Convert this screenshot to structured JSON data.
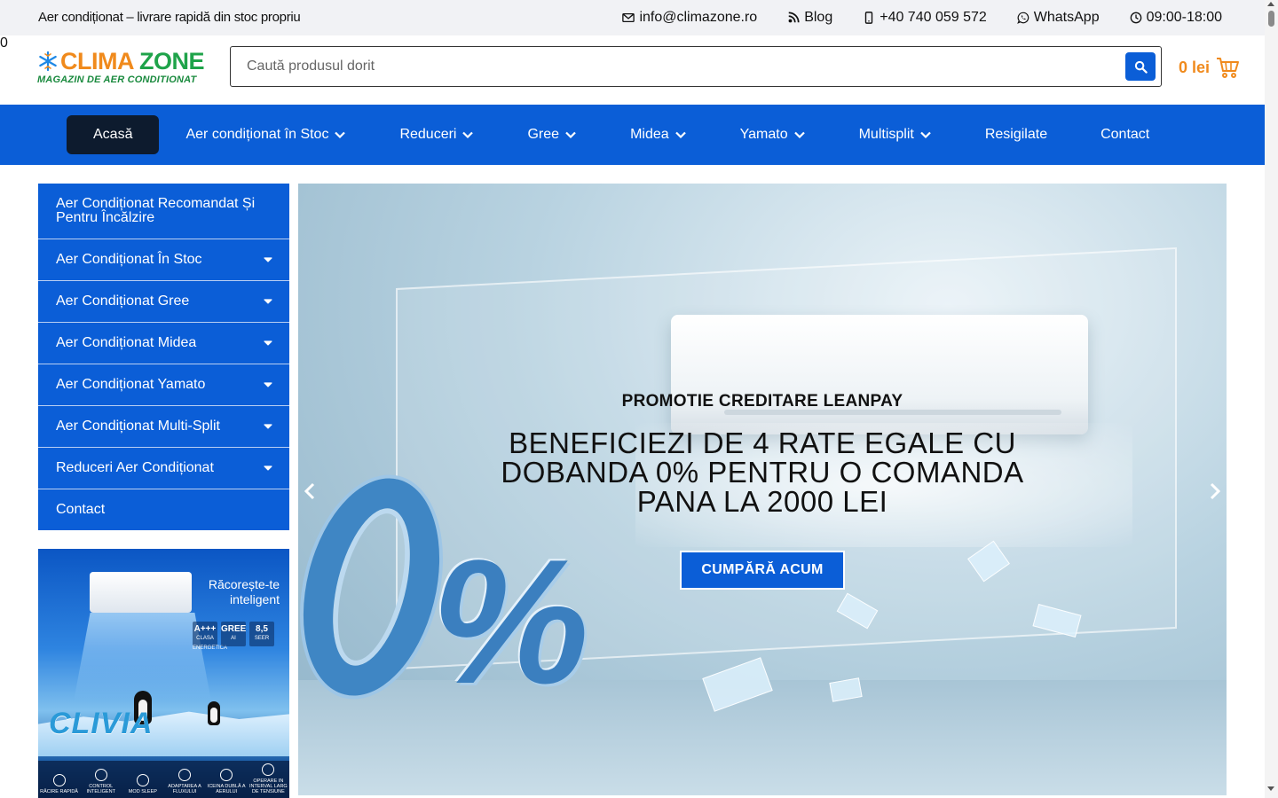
{
  "topbar": {
    "tagline": "Aer condiționat – livrare rapidă din stoc propriu",
    "contacts": [
      {
        "icon": "mail-icon",
        "label": "info@climazone.ro"
      },
      {
        "icon": "blog-icon",
        "label": "Blog"
      },
      {
        "icon": "phone-icon",
        "label": "+40 740 059 572"
      },
      {
        "icon": "whatsapp-icon",
        "label": "WhatsApp"
      },
      {
        "icon": "clock-icon",
        "label": "09:00-18:00"
      }
    ]
  },
  "header": {
    "logo": {
      "part1": "CLIMA",
      "part2": "ZONE",
      "subtitle": "MAGAZIN DE AER CONDITIONAT"
    },
    "search": {
      "placeholder": "Caută produsul dorit",
      "button_icon": "search-icon"
    },
    "cart": {
      "amount": "0 lei",
      "count": "0",
      "icon": "cart-icon"
    }
  },
  "nav": {
    "items": [
      {
        "label": "Acasă",
        "active": true,
        "dropdown": false
      },
      {
        "label": "Aer condiționat în Stoc",
        "dropdown": true
      },
      {
        "label": "Reduceri",
        "dropdown": true
      },
      {
        "label": "Gree",
        "dropdown": true
      },
      {
        "label": "Midea",
        "dropdown": true
      },
      {
        "label": "Yamato",
        "dropdown": true
      },
      {
        "label": "Multisplit",
        "dropdown": true
      },
      {
        "label": "Resigilate",
        "dropdown": false
      },
      {
        "label": "Contact",
        "dropdown": false
      }
    ]
  },
  "sidebar": {
    "items": [
      {
        "label": "Aer Condiționat Recomandat Și Pentru Încălzire",
        "dropdown": false
      },
      {
        "label": "Aer Condiționat În Stoc",
        "dropdown": true
      },
      {
        "label": "Aer Condiționat Gree",
        "dropdown": true
      },
      {
        "label": "Aer Condiționat Midea",
        "dropdown": true
      },
      {
        "label": "Aer Condiționat Yamato",
        "dropdown": true
      },
      {
        "label": "Aer Condiționat Multi-Split",
        "dropdown": true
      },
      {
        "label": "Reduceri Aer Condiționat",
        "dropdown": true
      },
      {
        "label": "Contact",
        "dropdown": false
      }
    ]
  },
  "promo_banner": {
    "slogan": "Răcorește-te inteligent",
    "specs": [
      {
        "value": "A+++",
        "caption": "CLASA ENERGETICA"
      },
      {
        "value": "GREE",
        "caption": "AI"
      },
      {
        "value": "8,5",
        "caption": "SEER"
      }
    ],
    "product_name": "CLIVIA",
    "features": [
      "RĂCIRE RAPIDĂ",
      "CONTROL INTELIGENT",
      "MOD SLEEP",
      "ADAPTAREA A FLUXULUI",
      "ICEINA DUBLĂ A AERULUI",
      "OPERARE IN INTERVAL LARG DE TENSIUNE"
    ]
  },
  "hero": {
    "kicker": "PROMOTIE CREDITARE LEANPAY",
    "headline": "BENEFICIEZI DE 4 RATE EGALE CU DOBANDA 0% PENTRU O COMANDA PANA LA 2000 LEI",
    "cta": "CUMPĂRĂ ACUM",
    "graphic_text": "0%"
  },
  "colors": {
    "brand_blue": "#0b5ed7",
    "brand_orange": "#f08a1c",
    "brand_green": "#1fa34a",
    "nav_active": "#0d1b2e"
  }
}
